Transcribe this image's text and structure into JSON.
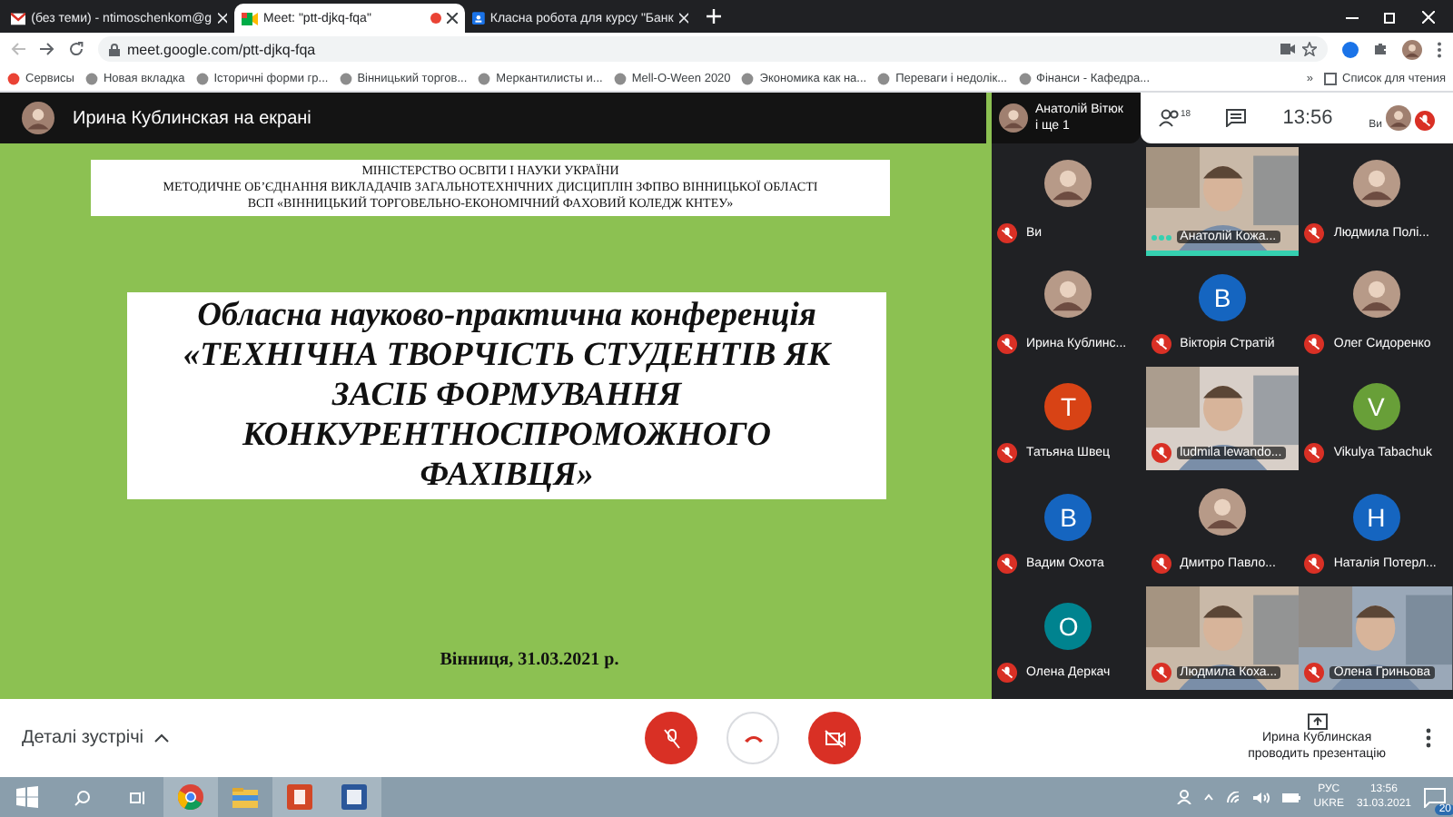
{
  "browser": {
    "tabs": [
      {
        "title": "(без теми) - ntimoschenkom@g",
        "selected": false,
        "recording": false
      },
      {
        "title": "Meet: \"ptt-djkq-fqa\"",
        "selected": true,
        "recording": true
      },
      {
        "title": "Класна робота для курсу \"Банк",
        "selected": false,
        "recording": false
      }
    ],
    "url": "meet.google.com/ptt-djkq-fqa",
    "bookmarks": [
      "Сервисы",
      "Новая вкладка",
      "Історичні форми гр...",
      "Вінницький торгов...",
      "Меркантилисты и...",
      "Mell-O-Ween 2020",
      "Экономика как на...",
      "Переваги і недолік...",
      "Фінанси - Кафедра..."
    ],
    "more_bookmarks": "»",
    "reading_list": "Список для чтения"
  },
  "presenter_bar": {
    "text": "Ирина Кублинская на екрані"
  },
  "slide": {
    "header": [
      "МІНІСТЕРСТВО ОСВІТИ І НАУКИ УКРАЇНИ",
      "МЕТОДИЧНЕ ОБ’ЄДНАННЯ ВИКЛАДАЧІВ ЗАГАЛЬНОТЕХНІЧНИХ ДИСЦИПЛІН ЗФПВО ВІННИЦЬКОЇ ОБЛАСТІ",
      "ВСП «ВІННИЦЬКИЙ ТОРГОВЕЛЬНО-ЕКОНОМІЧНИЙ ФАХОВИЙ КОЛЕДЖ КНТЕУ»"
    ],
    "title": [
      "Обласна науково-практична конференція",
      "«ТЕХНІЧНА ТВОРЧІСТЬ СТУДЕНТІВ ЯК",
      "ЗАСІБ ФОРМУВАННЯ",
      "КОНКУРЕНТНОСПРОМОЖНОГО",
      "ФАХІВЦЯ»"
    ],
    "footer": "Вінниця, 31.03.2021 р."
  },
  "top_overlay": {
    "pinned_name": "Анатолій Вітюк",
    "pinned_more": "і ще 1",
    "people_count": "18",
    "time": "13:56",
    "self_label": "Ви"
  },
  "tiles": [
    {
      "name": "Ви",
      "kind": "avatar",
      "muted": true
    },
    {
      "name": "Анатолій Кожа...",
      "kind": "video",
      "muted": false
    },
    {
      "name": "Людмила Полі...",
      "kind": "avatar",
      "muted": true
    },
    {
      "name": "Ирина Кублинс...",
      "kind": "avatar",
      "muted": true
    },
    {
      "name": "Вікторія Стратій",
      "kind": "letter",
      "letter": "В",
      "color": "#1565c0",
      "muted": true
    },
    {
      "name": "Олег Сидоренко",
      "kind": "avatar",
      "muted": true
    },
    {
      "name": "Татьяна Швец",
      "kind": "letter",
      "letter": "Т",
      "color": "#d84315",
      "muted": true
    },
    {
      "name": "ludmila lewando...",
      "kind": "video",
      "muted": true
    },
    {
      "name": "Vikulya Tabachuk",
      "kind": "letter",
      "letter": "V",
      "color": "#689f38",
      "muted": true
    },
    {
      "name": "Вадим Охота",
      "kind": "letter",
      "letter": "В",
      "color": "#1565c0",
      "muted": true
    },
    {
      "name": "Дмитро Павло...",
      "kind": "avatar",
      "muted": true
    },
    {
      "name": "Наталія Потерл...",
      "kind": "letter",
      "letter": "Н",
      "color": "#1565c0",
      "muted": true
    },
    {
      "name": "Олена Деркач",
      "kind": "letter",
      "letter": "О",
      "color": "#00838f",
      "muted": true
    },
    {
      "name": "Людмила Коха...",
      "kind": "video",
      "muted": true
    },
    {
      "name": "Олена Гриньова",
      "kind": "video",
      "muted": true
    }
  ],
  "bottom_bar": {
    "details": "Деталі зустрічі",
    "presenting": [
      "Ирина Кублинская",
      "проводить презентацію"
    ]
  },
  "taskbar": {
    "lang": [
      "РУС",
      "UKRE"
    ],
    "time": "13:56",
    "date": "31.03.2021",
    "notifications": "20"
  }
}
